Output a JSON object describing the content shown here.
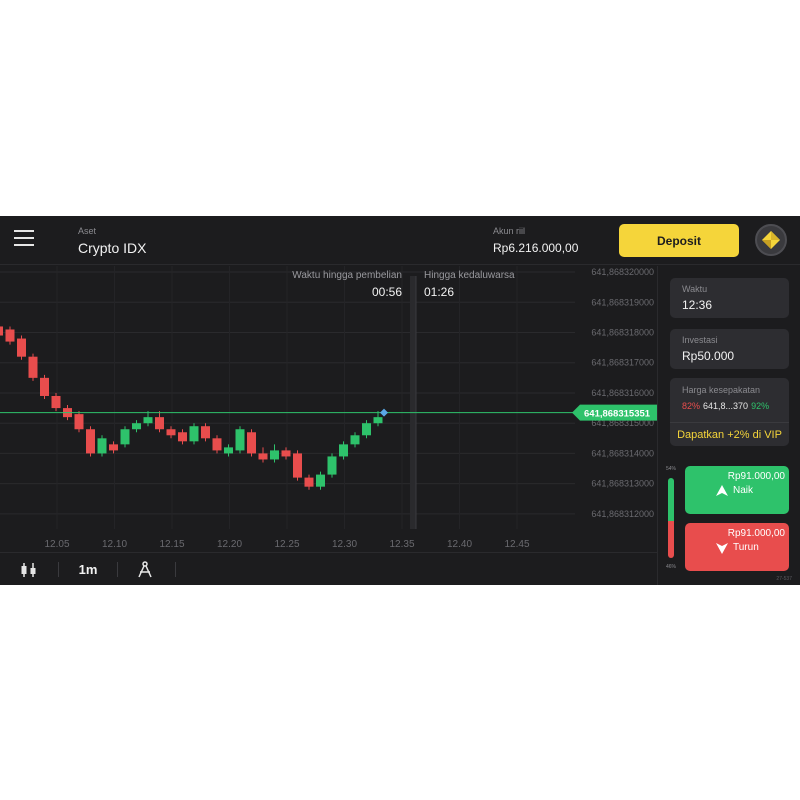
{
  "header": {
    "asset_label": "Aset",
    "asset_name": "Crypto IDX",
    "account_label": "Akun riil",
    "account_balance": "Rp6.216.000,00",
    "deposit_label": "Deposit"
  },
  "chart_info": {
    "purchase_timer_label": "Waktu hingga pembelian",
    "purchase_timer_value": "00:56",
    "expiry_label": "Hingga kedaluwarsa",
    "expiry_value": "01:26"
  },
  "chart_data": {
    "type": "candlestick",
    "x_ticks": [
      "12.05",
      "12.10",
      "12.15",
      "12.20",
      "12.25",
      "12.30",
      "12.35",
      "12.40",
      "12.45"
    ],
    "y_ticks": [
      "641,868320000",
      "641,868319000",
      "641,868318000",
      "641,868317000",
      "641,868316000",
      "641,868315000",
      "641,868314000",
      "641,868313000",
      "641,868312000"
    ],
    "ylim": [
      641.8683115,
      641.8683202
    ],
    "current_price": 641.868315351,
    "current_price_label": "641,868315351",
    "colors": {
      "up": "#2ec26b",
      "down": "#e84d4d",
      "price_line": "#2ec26b",
      "background": "#1c1c1e"
    },
    "candles": [
      {
        "t": "12.00",
        "o": 641.8683182,
        "c": 641.8683179,
        "h": 641.8683184,
        "l": 641.8683177
      },
      {
        "t": "12.01",
        "o": 641.8683181,
        "c": 641.8683177,
        "h": 641.8683182,
        "l": 641.8683176
      },
      {
        "t": "12.02",
        "o": 641.8683178,
        "c": 641.8683172,
        "h": 641.8683179,
        "l": 641.8683171
      },
      {
        "t": "12.03",
        "o": 641.8683172,
        "c": 641.8683165,
        "h": 641.8683173,
        "l": 641.8683164
      },
      {
        "t": "12.04",
        "o": 641.8683165,
        "c": 641.8683159,
        "h": 641.8683166,
        "l": 641.8683158
      },
      {
        "t": "12.05",
        "o": 641.8683159,
        "c": 641.8683155,
        "h": 641.868316,
        "l": 641.8683154
      },
      {
        "t": "12.06",
        "o": 641.8683155,
        "c": 641.8683152,
        "h": 641.8683156,
        "l": 641.8683151
      },
      {
        "t": "12.07",
        "o": 641.8683153,
        "c": 641.8683148,
        "h": 641.8683154,
        "l": 641.8683147
      },
      {
        "t": "12.08",
        "o": 641.8683148,
        "c": 641.868314,
        "h": 641.8683149,
        "l": 641.8683139
      },
      {
        "t": "12.09",
        "o": 641.868314,
        "c": 641.8683145,
        "h": 641.8683146,
        "l": 641.8683139
      },
      {
        "t": "12.10",
        "o": 641.8683143,
        "c": 641.8683141,
        "h": 641.8683144,
        "l": 641.868314
      },
      {
        "t": "12.11",
        "o": 641.8683143,
        "c": 641.8683148,
        "h": 641.8683149,
        "l": 641.8683142
      },
      {
        "t": "12.12",
        "o": 641.8683148,
        "c": 641.868315,
        "h": 641.8683151,
        "l": 641.8683147
      },
      {
        "t": "12.13",
        "o": 641.868315,
        "c": 641.8683152,
        "h": 641.8683154,
        "l": 641.8683149
      },
      {
        "t": "12.14",
        "o": 641.8683152,
        "c": 641.8683148,
        "h": 641.8683154,
        "l": 641.8683147
      },
      {
        "t": "12.15",
        "o": 641.8683148,
        "c": 641.8683146,
        "h": 641.8683149,
        "l": 641.8683145
      },
      {
        "t": "12.16",
        "o": 641.8683147,
        "c": 641.8683144,
        "h": 641.8683148,
        "l": 641.8683143
      },
      {
        "t": "12.17",
        "o": 641.8683144,
        "c": 641.8683149,
        "h": 641.868315,
        "l": 641.8683143
      },
      {
        "t": "12.18",
        "o": 641.8683149,
        "c": 641.8683145,
        "h": 641.868315,
        "l": 641.8683144
      },
      {
        "t": "12.19",
        "o": 641.8683145,
        "c": 641.8683141,
        "h": 641.8683146,
        "l": 641.868314
      },
      {
        "t": "12.20",
        "o": 641.868314,
        "c": 641.8683142,
        "h": 641.8683143,
        "l": 641.8683139
      },
      {
        "t": "12.21",
        "o": 641.8683141,
        "c": 641.8683148,
        "h": 641.8683149,
        "l": 641.868314
      },
      {
        "t": "12.22",
        "o": 641.8683147,
        "c": 641.868314,
        "h": 641.8683148,
        "l": 641.8683139
      },
      {
        "t": "12.23",
        "o": 641.868314,
        "c": 641.8683138,
        "h": 641.8683142,
        "l": 641.8683137
      },
      {
        "t": "12.24",
        "o": 641.8683138,
        "c": 641.8683141,
        "h": 641.8683143,
        "l": 641.8683137
      },
      {
        "t": "12.25",
        "o": 641.8683141,
        "c": 641.8683139,
        "h": 641.8683142,
        "l": 641.8683138
      },
      {
        "t": "12.26",
        "o": 641.868314,
        "c": 641.8683132,
        "h": 641.8683141,
        "l": 641.8683131
      },
      {
        "t": "12.27",
        "o": 641.8683132,
        "c": 641.8683129,
        "h": 641.8683133,
        "l": 641.8683128
      },
      {
        "t": "12.28",
        "o": 641.8683129,
        "c": 641.8683133,
        "h": 641.8683134,
        "l": 641.8683128
      },
      {
        "t": "12.29",
        "o": 641.8683133,
        "c": 641.8683139,
        "h": 641.868314,
        "l": 641.8683132
      },
      {
        "t": "12.30",
        "o": 641.8683139,
        "c": 641.8683143,
        "h": 641.8683144,
        "l": 641.8683138
      },
      {
        "t": "12.31",
        "o": 641.8683143,
        "c": 641.8683146,
        "h": 641.8683147,
        "l": 641.8683142
      },
      {
        "t": "12.32",
        "o": 641.8683146,
        "c": 641.868315,
        "h": 641.8683151,
        "l": 641.8683145
      },
      {
        "t": "12.33",
        "o": 641.868315,
        "c": 641.8683152,
        "h": 641.8683154,
        "l": 641.8683149
      }
    ]
  },
  "toolbar": {
    "timeframe": "1m",
    "chart_type_icon": "candles-icon",
    "drawing_icon": "drawing-compass-icon"
  },
  "panel": {
    "time_label": "Waktu",
    "time_value": "12:36",
    "investment_label": "Investasi",
    "investment_value": "Rp50.000",
    "payout_label": "Harga kesepakatan",
    "payout_low": "82%",
    "payout_price": "641,8...370",
    "payout_high": "92%",
    "vip_offer": "Dapatkan +2% di VIP",
    "sentiment_up_label": "54%",
    "sentiment_down_label": "46%",
    "sentiment_up_percent": 54,
    "up_amount": "Rp91.000,00",
    "up_label": "Naik",
    "down_amount": "Rp91.000,00",
    "down_label": "Turun",
    "footer_note": "27-537"
  }
}
